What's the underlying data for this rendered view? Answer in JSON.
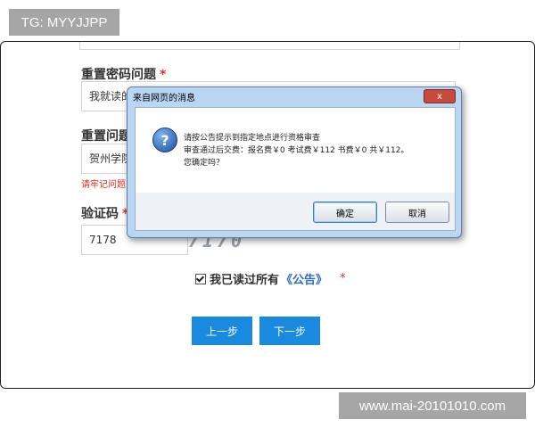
{
  "watermarks": {
    "top_left": "TG: MYYJJPP",
    "bottom_right": "www.mai-20101010.com"
  },
  "form": {
    "reset_question_label": "重置密码问题",
    "reset_question_value": "我就读的",
    "reset_answer_label": "重置问题",
    "reset_answer_value": "贺州学院",
    "reset_hint": "请牢记问题",
    "required_mark": "*",
    "captcha_label": "验证码",
    "captcha_value": "7178",
    "captcha_image_text": "7170",
    "agree_text": "我已读过所有",
    "notice_link": "《公告》",
    "prev_button": "上一步",
    "next_button": "下一步"
  },
  "dialog": {
    "title": "来自网页的消息",
    "close_label": "x",
    "message_line1": "请按公告提示到指定地点进行资格审查",
    "message_line2": "审查通过后交费：报名费￥0 考试费￥112 书费￥0 共￥112。",
    "message_line3": "您确定吗？",
    "ok_button": "确定",
    "cancel_button": "取消",
    "icon": "question-icon"
  }
}
